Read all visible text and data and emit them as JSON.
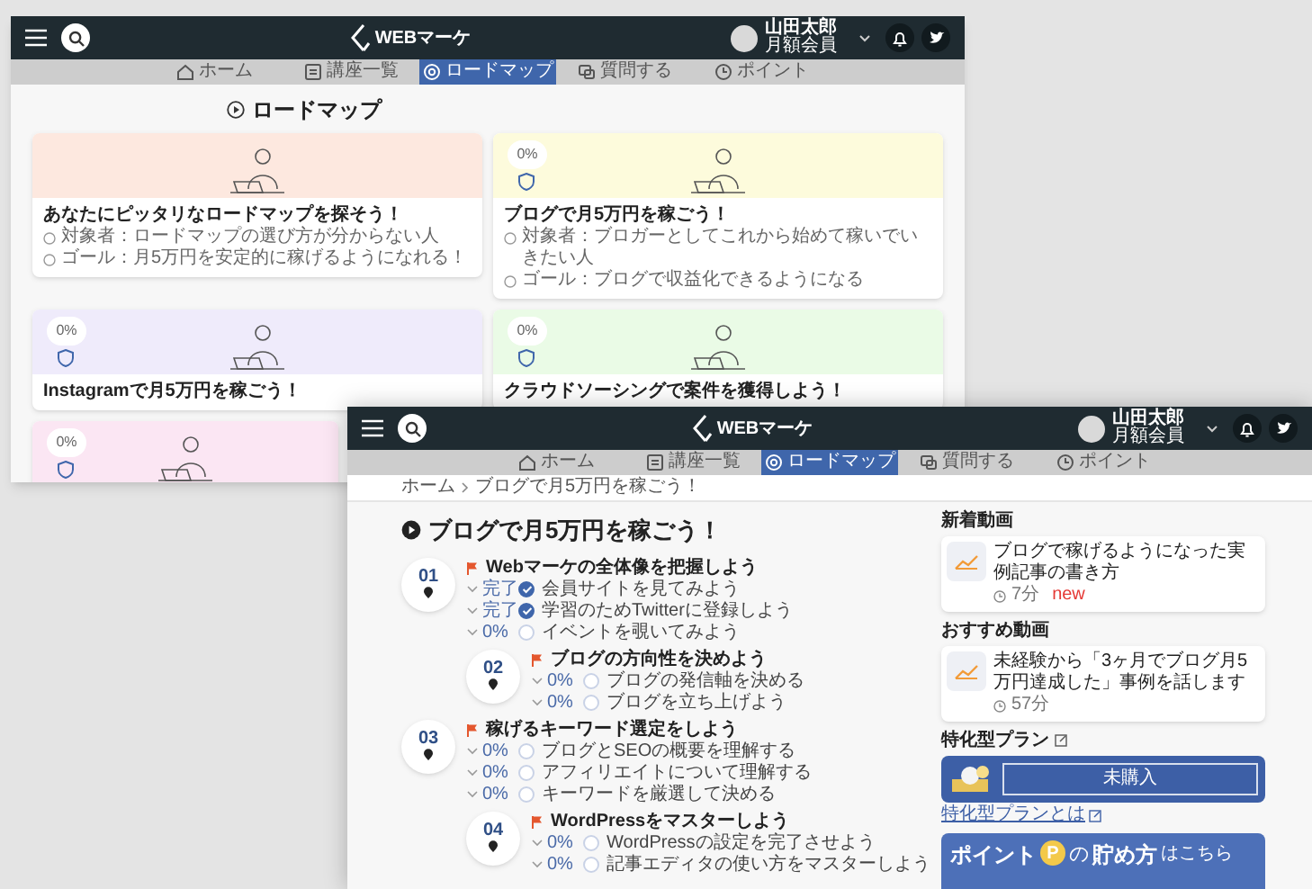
{
  "back_window": {
    "logo": "WEBマーケ",
    "user": {
      "name": "山田太郎",
      "plan": "月額会員"
    },
    "nav": [
      {
        "label": "ホーム",
        "selected": false
      },
      {
        "label": "講座一覧",
        "selected": false
      },
      {
        "label": "ロードマップ",
        "selected": true
      },
      {
        "label": "質問する",
        "selected": false
      },
      {
        "label": "ポイント",
        "selected": false
      }
    ],
    "title": "ロードマップ",
    "cards": [
      {
        "color": "#fde8df",
        "title": "あなたにピッタリなロードマップを探そう！",
        "details": [
          "対象者：ロードマップの選び方が分からない人",
          "ゴール：月5万円を安定的に稼げるようになれる！"
        ]
      },
      {
        "color": "#fdfbdc",
        "badge": "0%",
        "title": "ブログで月5万円を稼ごう！",
        "details": [
          "対象者：ブロガーとしてこれから始めて稼いでいきたい人",
          "ゴール：ブログで収益化できるようになる"
        ]
      },
      {
        "color": "#efebfb",
        "badge": "0%",
        "title": "Instagramで月5万円を稼ごう！"
      },
      {
        "color": "#eafbe6",
        "badge": "0%",
        "title": "クラウドソーシングで案件を獲得しよう！"
      },
      {
        "color": "#fbe6f3",
        "badge": "0%"
      }
    ]
  },
  "front_window": {
    "logo": "WEBマーケ",
    "user": {
      "name": "山田太郎",
      "plan": "月額会員"
    },
    "nav": [
      {
        "label": "ホーム",
        "selected": false
      },
      {
        "label": "講座一覧",
        "selected": false
      },
      {
        "label": "ロードマップ",
        "selected": true
      },
      {
        "label": "質問する",
        "selected": false
      },
      {
        "label": "ポイント",
        "selected": false
      }
    ],
    "breadcrumb": [
      "ホーム",
      "ブログで月5万円を稼ごう！"
    ],
    "title": "ブログで月5万円を稼ごう！",
    "steps": [
      {
        "number": "01",
        "title": "Webマーケの全体像を把握しよう",
        "items": [
          {
            "status": "完了",
            "checked": true,
            "label": "会員サイトを見てみよう"
          },
          {
            "status": "完了",
            "checked": true,
            "label": "学習のためTwitterに登録しよう"
          },
          {
            "status": "0%",
            "checked": false,
            "label": "イベントを覗いてみよう"
          }
        ]
      },
      {
        "number": "02",
        "title": "ブログの方向性を決めよう",
        "items": [
          {
            "status": "0%",
            "checked": false,
            "label": "ブログの発信軸を決める"
          },
          {
            "status": "0%",
            "checked": false,
            "label": "ブログを立ち上げよう"
          }
        ]
      },
      {
        "number": "03",
        "title": "稼げるキーワード選定をしよう",
        "items": [
          {
            "status": "0%",
            "checked": false,
            "label": "ブログとSEOの概要を理解する"
          },
          {
            "status": "0%",
            "checked": false,
            "label": "アフィリエイトについて理解する"
          },
          {
            "status": "0%",
            "checked": false,
            "label": "キーワードを厳選して決める"
          }
        ]
      },
      {
        "number": "04",
        "title": "WordPressをマスターしよう",
        "items": [
          {
            "status": "0%",
            "checked": false,
            "label": "WordPressの設定を完了させよう"
          },
          {
            "status": "0%",
            "checked": false,
            "label": "記事エディタの使い方をマスターしよう"
          }
        ]
      }
    ],
    "sidebar": {
      "new_videos": {
        "heading": "新着動画",
        "video": {
          "title": "ブログで稼げるようになった実例記事の書き方",
          "duration": "7分",
          "badge": "new"
        }
      },
      "recommended": {
        "heading": "おすすめ動画",
        "video": {
          "title": "未経験から「3ヶ月でブログ月5万円達成した」事例を話します",
          "duration": "57分"
        }
      },
      "plan": {
        "heading": "特化型プラン",
        "button": "未購入",
        "link": "特化型プランとは"
      },
      "points_banner": {
        "word1": "ポイント",
        "coin": "P",
        "word2": "の",
        "word3": "貯め方",
        "word4": "はこちら"
      }
    }
  }
}
